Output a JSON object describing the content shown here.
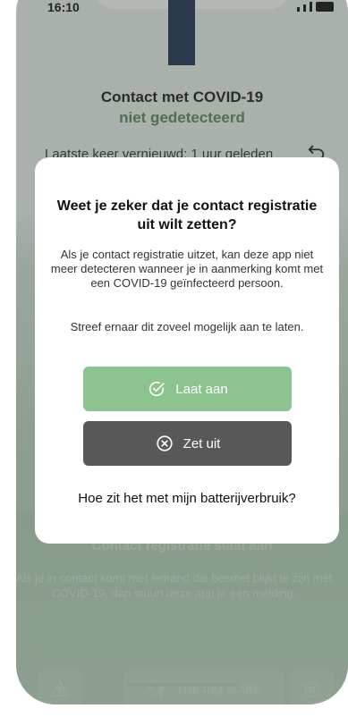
{
  "statusbar": {
    "time": "16:10"
  },
  "header": {
    "title": "Contact met COVID-19",
    "status": "niet gedetecteerd",
    "refreshed": "Laatste keer vernieuwd: 1 uur geleden"
  },
  "background": {
    "subtitle": "Contact registratie staat aan",
    "description": "Als je in contact komt met iemand die besmet blijkt te zijn met COVID-19, dan stuurt deze app je een melding."
  },
  "tabbar": {
    "warning_icon": "warning-icon",
    "score_label": "Tracing score",
    "score_icon": "star-icon",
    "settings_icon": "gear-icon"
  },
  "dialog": {
    "title": "Weet je zeker dat je contact registratie uit wilt zetten?",
    "body": "Als je contact registratie uitzet, kan deze app niet meer detecteren wanneer je in aanmerking komt met een COVID-19 geïnfecteerd persoon.",
    "body2": "Streef ernaar dit zoveel mogelijk aan te laten.",
    "keep_label": "Laat aan",
    "off_label": "Zet uit",
    "battery_link": "Hoe zit het met mijn batterijverbruik?"
  },
  "colors": {
    "accent_green": "#8cc38f",
    "status_green": "#5b8a5e",
    "dark_button": "#585858",
    "navy_bar": "#1d2f52"
  }
}
